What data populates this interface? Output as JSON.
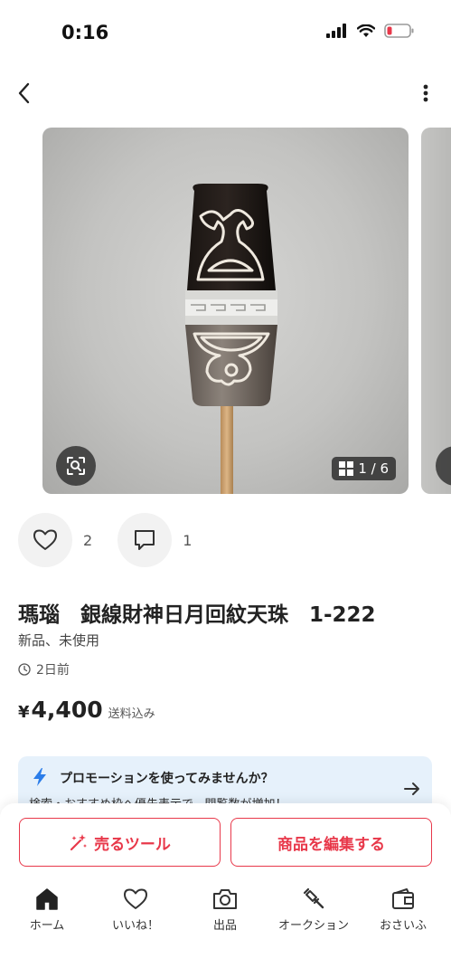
{
  "status": {
    "time": "0:16"
  },
  "gallery": {
    "counter": "1 / 6"
  },
  "reactions": {
    "likes": "2",
    "comments": "1"
  },
  "item": {
    "title": "瑪瑙　銀線財神日月回紋天珠　1-222",
    "condition": "新品、未使用",
    "posted": "2日前",
    "price_symbol": "¥",
    "price": "4,400",
    "price_note": "送料込み"
  },
  "promo": {
    "title": "プロモーションを使ってみませんか？",
    "subtitle": "検索・おすすめ枠へ優先表示で、閲覧数が増加！"
  },
  "actions": {
    "sell_tool": "売るツール",
    "edit_item": "商品を編集する"
  },
  "tabs": [
    {
      "label": "ホーム",
      "icon": "home-icon"
    },
    {
      "label": "いいね！",
      "icon": "heart-icon"
    },
    {
      "label": "出品",
      "icon": "camera-icon"
    },
    {
      "label": "オークション",
      "icon": "gavel-icon"
    },
    {
      "label": "おさいふ",
      "icon": "wallet-icon"
    }
  ],
  "colors": {
    "accent": "#e8384a",
    "promo_bg": "#e6f1fb",
    "promo_bolt": "#2b7de9"
  }
}
